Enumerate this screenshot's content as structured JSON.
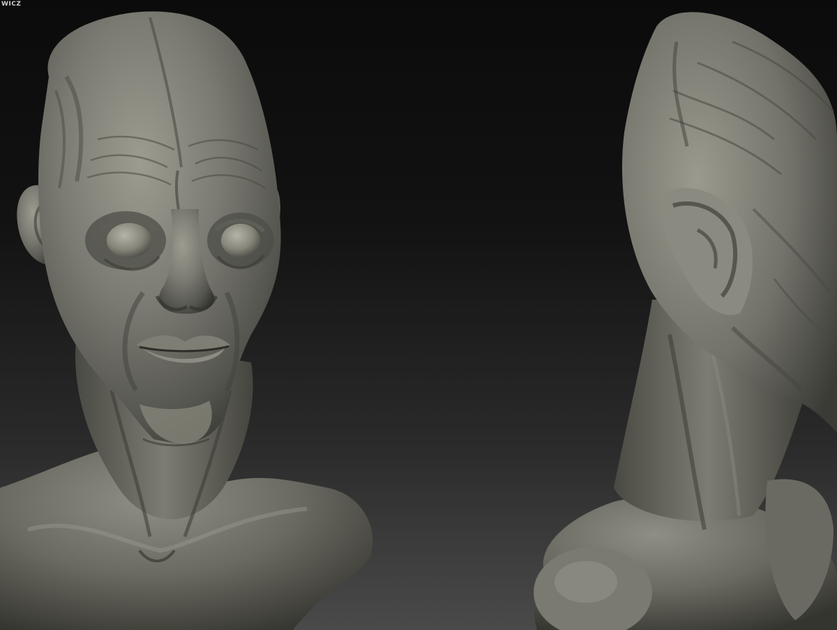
{
  "watermark": {
    "text": "WICZ"
  },
  "palette": {
    "clay_light": "#9a9a8e",
    "clay_mid": "#6e6e66",
    "clay_dark": "#3a3a36",
    "background_top": "#0b0b0b",
    "background_bottom": "#4a4a4a"
  }
}
